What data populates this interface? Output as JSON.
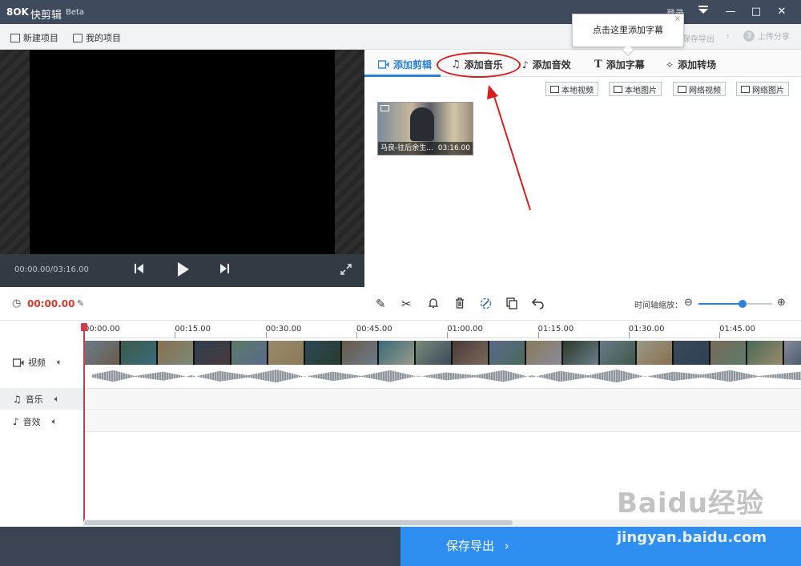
{
  "titlebar": {
    "logo": "8OK",
    "title": "快剪辑",
    "beta": "Beta",
    "login": "登录",
    "minimize_icon": "—",
    "maximize_icon": "□",
    "close_icon": "✕"
  },
  "toolbar": {
    "new_project": "新建项目",
    "my_projects": "我的项目",
    "export_step": "保存导出",
    "share_step_num": "3",
    "share_step": "上传分享"
  },
  "tooltip": {
    "text": "点击这里添加字幕",
    "close": "×"
  },
  "player": {
    "time": "00:00.00/03:16.00"
  },
  "media_tabs": [
    {
      "label": "添加剪辑",
      "icon": "video-camera-icon"
    },
    {
      "label": "添加音乐",
      "icon": "music-note-icon"
    },
    {
      "label": "添加音效",
      "icon": "sound-effect-icon"
    },
    {
      "label": "添加字幕",
      "icon": "text-t-icon"
    },
    {
      "label": "添加转场",
      "icon": "transition-star-icon"
    }
  ],
  "source_buttons": [
    "本地视频",
    "本地图片",
    "网络视频",
    "网络图片"
  ],
  "clip": {
    "name": "马良-往后余生...",
    "duration": "03:16.00"
  },
  "edit_bar": {
    "current_time": "00:00.00",
    "zoom_label": "时间轴缩放：",
    "zoom_level": 0.6
  },
  "ruler_ticks": [
    "00:00.00",
    "00:15.00",
    "00:30.00",
    "00:45.00",
    "01:00.00",
    "01:15.00",
    "01:30.00",
    "01:45.00"
  ],
  "tracks": {
    "video": "视频",
    "music": "音乐",
    "sfx": "音效"
  },
  "bottom": {
    "save_export": "保存导出",
    "chevron": "›"
  },
  "watermark": {
    "brand": "Baidu经验",
    "url": "jingyan.baidu.com"
  },
  "colors": {
    "accent": "#2b82d9",
    "highlight": "#d62020",
    "time_red": "#d23b2b"
  }
}
